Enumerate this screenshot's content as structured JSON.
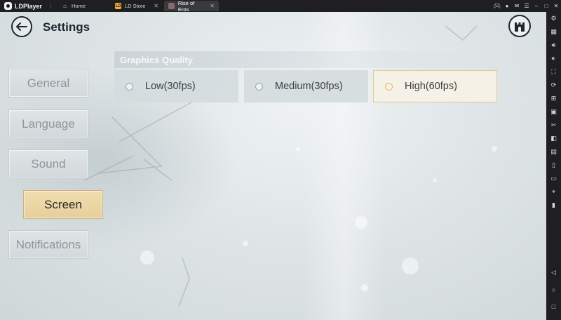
{
  "emulator": {
    "brand": "LDPlayer",
    "tabs": [
      {
        "label": "Home",
        "icon": "home-icon"
      },
      {
        "label": "LD Store",
        "icon": "store-icon"
      },
      {
        "label": "Rise of Eros",
        "icon": "game-icon"
      }
    ],
    "window_controls": [
      "gamepad-icon",
      "account-icon",
      "mail-icon",
      "menu-icon",
      "minimize-icon",
      "maximize-icon",
      "close-icon"
    ],
    "right_toolbar": [
      "settings-icon",
      "keyboard-icon",
      "volume-up-icon",
      "volume-down-icon",
      "fullscreen-icon",
      "rotate-icon",
      "add-apk-icon",
      "record-icon",
      "scissors-icon",
      "operation-icon",
      "sync-icon",
      "shake-icon",
      "folder-icon",
      "location-icon",
      "vibrate-icon",
      "back-nav-icon",
      "home-nav-icon",
      "recents-nav-icon"
    ]
  },
  "settings": {
    "title": "Settings",
    "nav": [
      {
        "label": "General",
        "selected": false
      },
      {
        "label": "Language",
        "selected": false
      },
      {
        "label": "Sound",
        "selected": false
      },
      {
        "label": "Screen",
        "selected": true
      },
      {
        "label": "Notifications",
        "selected": false
      }
    ],
    "graphics_quality": {
      "header": "Graphics Quality",
      "options": [
        {
          "label": "Low(30fps)",
          "selected": false
        },
        {
          "label": "Medium(30fps)",
          "selected": false
        },
        {
          "label": "High(60fps)",
          "selected": true
        }
      ]
    }
  }
}
